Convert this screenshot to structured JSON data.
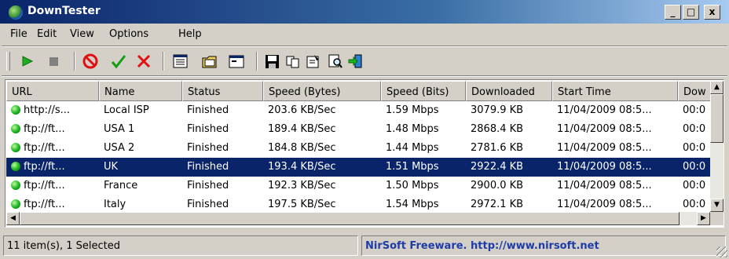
{
  "window": {
    "title": "DownTester",
    "min_label": "_",
    "max_label": "□",
    "close_label": "x"
  },
  "menu": [
    "File",
    "Edit",
    "View",
    "Options",
    "Help"
  ],
  "toolbar": {
    "icons": [
      "play-icon",
      "stop-icon",
      "no-entry-icon",
      "checkmark-icon",
      "x-icon",
      "list-view-icon",
      "folder-icon",
      "window-icon",
      "save-icon",
      "copy-icon",
      "properties-icon",
      "find-icon",
      "exit-icon"
    ]
  },
  "columns": [
    "URL",
    "Name",
    "Status",
    "Speed (Bytes)",
    "Speed (Bits)",
    "Downloaded",
    "Start Time",
    "Dow"
  ],
  "rows": [
    {
      "url": "http://s...",
      "name": "Local ISP",
      "status": "Finished",
      "speed_bytes": "203.6 KB/Sec",
      "speed_bits": "1.59 Mbps",
      "downloaded": "3079.9 KB",
      "start_time": "11/04/2009 08:5...",
      "dow": "00:0",
      "selected": false
    },
    {
      "url": "ftp://ft...",
      "name": "USA 1",
      "status": "Finished",
      "speed_bytes": "189.4 KB/Sec",
      "speed_bits": "1.48 Mbps",
      "downloaded": "2868.4 KB",
      "start_time": "11/04/2009 08:5...",
      "dow": "00:0",
      "selected": false
    },
    {
      "url": "ftp://ft...",
      "name": "USA 2",
      "status": "Finished",
      "speed_bytes": "184.8 KB/Sec",
      "speed_bits": "1.44 Mbps",
      "downloaded": "2781.6 KB",
      "start_time": "11/04/2009 08:5...",
      "dow": "00:0",
      "selected": false
    },
    {
      "url": "ftp://ft...",
      "name": "UK",
      "status": "Finished",
      "speed_bytes": "193.4 KB/Sec",
      "speed_bits": "1.51 Mbps",
      "downloaded": "2922.4 KB",
      "start_time": "11/04/2009 08:5...",
      "dow": "00:0",
      "selected": true
    },
    {
      "url": "ftp://ft...",
      "name": "France",
      "status": "Finished",
      "speed_bytes": "192.3 KB/Sec",
      "speed_bits": "1.50 Mbps",
      "downloaded": "2900.0 KB",
      "start_time": "11/04/2009 08:5...",
      "dow": "00:0",
      "selected": false
    },
    {
      "url": "ftp://ft...",
      "name": "Italy",
      "status": "Finished",
      "speed_bytes": "197.5 KB/Sec",
      "speed_bits": "1.54 Mbps",
      "downloaded": "2972.1 KB",
      "start_time": "11/04/2009 08:5...",
      "dow": "00:0",
      "selected": false
    }
  ],
  "status": {
    "items": "11 item(s), 1 Selected",
    "credit": "NirSoft Freeware.  http://www.nirsoft.net"
  },
  "colors": {
    "selection": "#0a246a",
    "credit_text": "#1e3ca8",
    "status_dot": "#19b41e"
  }
}
